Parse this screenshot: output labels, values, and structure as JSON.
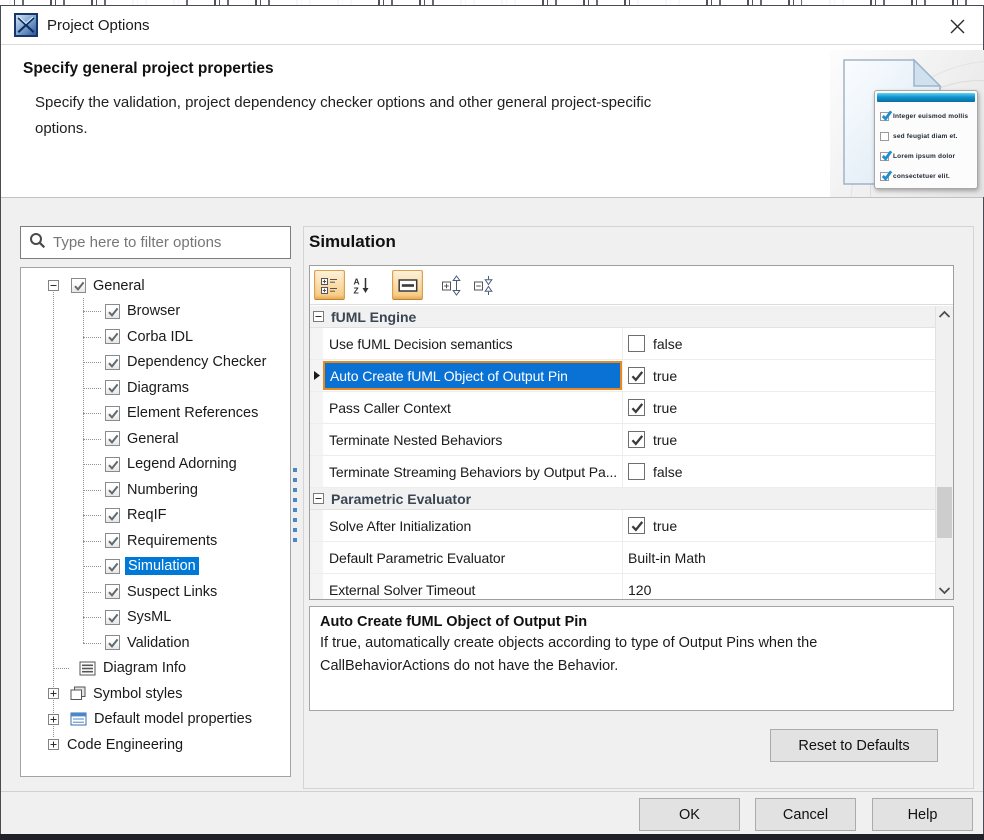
{
  "titlebar": {
    "title": "Project Options"
  },
  "header": {
    "title": "Specify general project properties",
    "description_lines": [
      "Specify the validation, project dependency checker options and other general project-specific",
      "options."
    ],
    "graphic_checklist": [
      {
        "checked": true,
        "text": "Integer euismod mollis"
      },
      {
        "checked": false,
        "text": "sed feugiat diam et."
      },
      {
        "checked": true,
        "text": "Lorem ipsum dolor"
      },
      {
        "checked": true,
        "text": "consectetuer elit."
      }
    ]
  },
  "left_panel": {
    "filter_placeholder": "Type here to filter options",
    "tree": {
      "root": {
        "label": "General",
        "checked": true,
        "expanded": true
      },
      "children": [
        {
          "label": "Browser",
          "checked": true
        },
        {
          "label": "Corba IDL",
          "checked": true
        },
        {
          "label": "Dependency Checker",
          "checked": true
        },
        {
          "label": "Diagrams",
          "checked": true
        },
        {
          "label": "Element References",
          "checked": true
        },
        {
          "label": "General",
          "checked": true
        },
        {
          "label": "Legend Adorning",
          "checked": true
        },
        {
          "label": "Numbering",
          "checked": true
        },
        {
          "label": "ReqIF",
          "checked": true
        },
        {
          "label": "Requirements",
          "checked": true
        },
        {
          "label": "Simulation",
          "checked": true,
          "selected": true
        },
        {
          "label": "Suspect Links",
          "checked": true
        },
        {
          "label": "SysML",
          "checked": true
        },
        {
          "label": "Validation",
          "checked": true
        }
      ],
      "siblings": [
        {
          "label": "Diagram Info",
          "icon": "diagram-info-icon",
          "expandable": false
        },
        {
          "label": "Symbol styles",
          "icon": "symbol-styles-icon",
          "expandable": true
        },
        {
          "label": "Default model properties",
          "icon": "model-properties-icon",
          "expandable": true
        },
        {
          "label": "Code Engineering",
          "icon": null,
          "expandable": true
        }
      ]
    }
  },
  "right_panel": {
    "title": "Simulation",
    "toolbar": [
      {
        "name": "categorized-view-button",
        "active": true
      },
      {
        "name": "sort-alphabetically-button",
        "active": false
      },
      {
        "name": "show-description-button",
        "active": true
      },
      {
        "name": "expand-all-button",
        "active": false
      },
      {
        "name": "collapse-all-button",
        "active": false
      }
    ],
    "groups": [
      {
        "label": "fUML Engine",
        "rows": [
          {
            "name": "Use fUML Decision semantics",
            "checkbox": true,
            "checked": false,
            "value": "false"
          },
          {
            "name": "Auto Create fUML Object of Output Pin",
            "checkbox": true,
            "checked": true,
            "value": "true",
            "selected": true
          },
          {
            "name": "Pass Caller Context",
            "checkbox": true,
            "checked": true,
            "value": "true"
          },
          {
            "name": "Terminate Nested Behaviors",
            "checkbox": true,
            "checked": true,
            "value": "true"
          },
          {
            "name": "Terminate Streaming Behaviors by Output Pa...",
            "checkbox": true,
            "checked": false,
            "value": "false"
          }
        ]
      },
      {
        "label": "Parametric Evaluator",
        "rows": [
          {
            "name": "Solve After Initialization",
            "checkbox": true,
            "checked": true,
            "value": "true"
          },
          {
            "name": "Default Parametric Evaluator",
            "checkbox": false,
            "value": "Built-in Math"
          },
          {
            "name": "External Solver Timeout",
            "checkbox": false,
            "value": "120"
          }
        ]
      }
    ],
    "description": {
      "title": "Auto Create fUML Object of Output Pin",
      "lines": [
        "If true, automatically create objects according to type of Output Pins when the",
        "CallBehaviorActions do not have the Behavior."
      ]
    },
    "reset_label": "Reset to Defaults"
  },
  "footer": {
    "buttons": [
      "OK",
      "Cancel",
      "Help"
    ]
  },
  "colors": {
    "selection_blue": "#0078d7",
    "selection_orange_border": "#e8891d",
    "toolbar_active_orange": "#fbdba6",
    "splitter_blue": "#4a86c8",
    "graphic_header_blue": "#0f95cf"
  }
}
